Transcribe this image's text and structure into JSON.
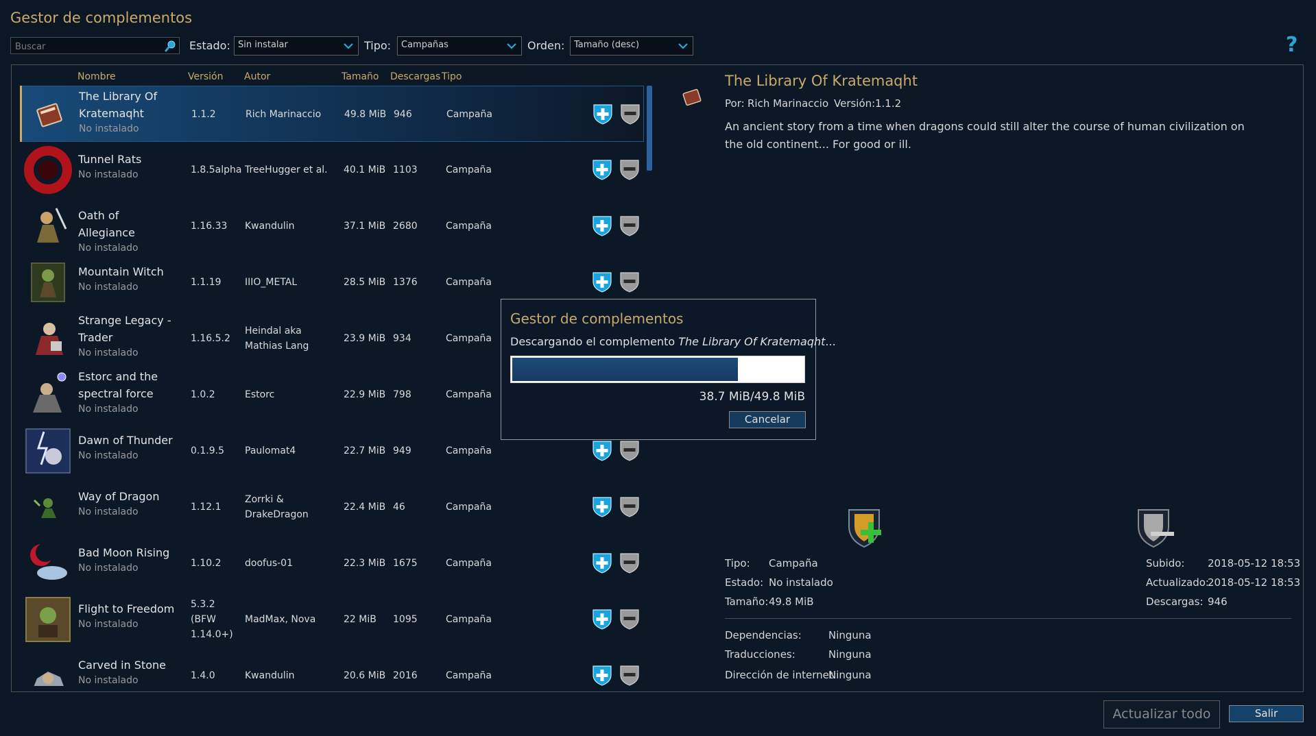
{
  "app": {
    "title": "Gestor de complementos"
  },
  "filters": {
    "search_placeholder": "Buscar",
    "state_label": "Estado:",
    "state_value": "Sin instalar",
    "type_label": "Tipo:",
    "type_value": "Campañas",
    "order_label": "Orden:",
    "order_value": "Tamaño (desc)"
  },
  "help": {
    "label": "?"
  },
  "list": {
    "headers": {
      "name": "Nombre",
      "version": "Versión",
      "author": "Autor",
      "size": "Tamaño",
      "downloads": "Descargas",
      "type": "Tipo"
    },
    "rows": [
      {
        "name": "The Library Of Kratemaqht",
        "status": "No instalado",
        "version": "1.1.2",
        "author": "Rich Marinaccio",
        "size": "49.8 MiB",
        "downloads": "946",
        "type": "Campaña",
        "icon": "book-icon"
      },
      {
        "name": "Tunnel Rats",
        "status": "No instalado",
        "version": "1.8.5alpha",
        "author": "TreeHugger et al.",
        "size": "40.1 MiB",
        "downloads": "1103",
        "type": "Campaña",
        "icon": "red-ring-icon"
      },
      {
        "name": "Oath of Allegiance",
        "status": "No instalado",
        "version": "1.16.33",
        "author": "Kwandulin",
        "size": "37.1 MiB",
        "downloads": "2680",
        "type": "Campaña",
        "icon": "warrior-icon"
      },
      {
        "name": "Mountain Witch",
        "status": "No instalado",
        "version": "1.1.19",
        "author": "IIIO_METAL",
        "size": "28.5 MiB",
        "downloads": "1376",
        "type": "Campaña",
        "icon": "witch-icon"
      },
      {
        "name": "Strange Legacy - Trader",
        "status": "No instalado",
        "version": "1.16.5.2",
        "author": "Heindal aka Mathias Lang",
        "size": "23.9 MiB",
        "downloads": "934",
        "type": "Campaña",
        "icon": "trader-icon"
      },
      {
        "name": "Estorc and the spectral force",
        "status": "No instalado",
        "version": "1.0.2",
        "author": "Estorc",
        "size": "22.9 MiB",
        "downloads": "798",
        "type": "Campaña",
        "icon": "mage-icon"
      },
      {
        "name": "Dawn of Thunder",
        "status": "No instalado",
        "version": "0.1.9.5",
        "author": "Paulomat4",
        "size": "22.7 MiB",
        "downloads": "949",
        "type": "Campaña",
        "icon": "lightning-icon"
      },
      {
        "name": "Way of Dragon",
        "status": "No instalado",
        "version": "1.12.1",
        "author": "Zorrki & DrakeDragon",
        "size": "22.4 MiB",
        "downloads": "46",
        "type": "Campaña",
        "icon": "dragon-icon"
      },
      {
        "name": "Bad Moon Rising",
        "status": "No instalado",
        "version": "1.10.2",
        "author": "doofus-01",
        "size": "22.3 MiB",
        "downloads": "1675",
        "type": "Campaña",
        "icon": "moon-icon"
      },
      {
        "name": "Flight to Freedom",
        "status": "No instalado",
        "version": "5.3.2 (BFW 1.14.0+)",
        "author": "MadMax, Nova",
        "size": "22 MiB",
        "downloads": "1095",
        "type": "Campaña",
        "icon": "goblin-icon"
      },
      {
        "name": "Carved in Stone",
        "status": "No instalado",
        "version": "1.4.0",
        "author": "Kwandulin",
        "size": "20.6 MiB",
        "downloads": "2016",
        "type": "Campaña",
        "icon": "stone-icon"
      }
    ]
  },
  "details": {
    "title": "The Library Of Kratemaqht",
    "by_label": "Por:",
    "author": "Rich Marinaccio",
    "version_label": "Versión:",
    "version": "1.1.2",
    "description": "An ancient story from a time when dragons could still alter the course of human civilization on the old continent... For good or ill.",
    "type_label": "Tipo:",
    "type": "Campaña",
    "state_label": "Estado:",
    "state": "No instalado",
    "size_label": "Tamaño:",
    "size": "49.8 MiB",
    "uploaded_label": "Subido:",
    "uploaded": "2018-05-12 18:53",
    "updated_label": "Actualizado:",
    "updated": "2018-05-12 18:53",
    "downloads_label": "Descargas:",
    "downloads": "946",
    "dependencies_label": "Dependencias:",
    "dependencies": "Ninguna",
    "translations_label": "Traducciones:",
    "translations": "Ninguna",
    "web_label": "Dirección de internet:",
    "web": "Ninguna"
  },
  "dialog": {
    "title": "Gestor de complementos",
    "message_prefix": "Descargando el complemento ",
    "message_addon": "The Library Of Kratemaqht",
    "message_suffix": "...",
    "progress_text": "38.7 MiB/49.8 MiB",
    "progress_fraction": 0.777,
    "cancel_label": "Cancelar"
  },
  "footer": {
    "update_all_label": "Actualizar todo",
    "exit_label": "Salir"
  },
  "colors": {
    "background": "#0c1726",
    "accent_gold": "#c9aa6a",
    "selection_blue": "#184a78",
    "install_blue": "#1ba3dd"
  }
}
